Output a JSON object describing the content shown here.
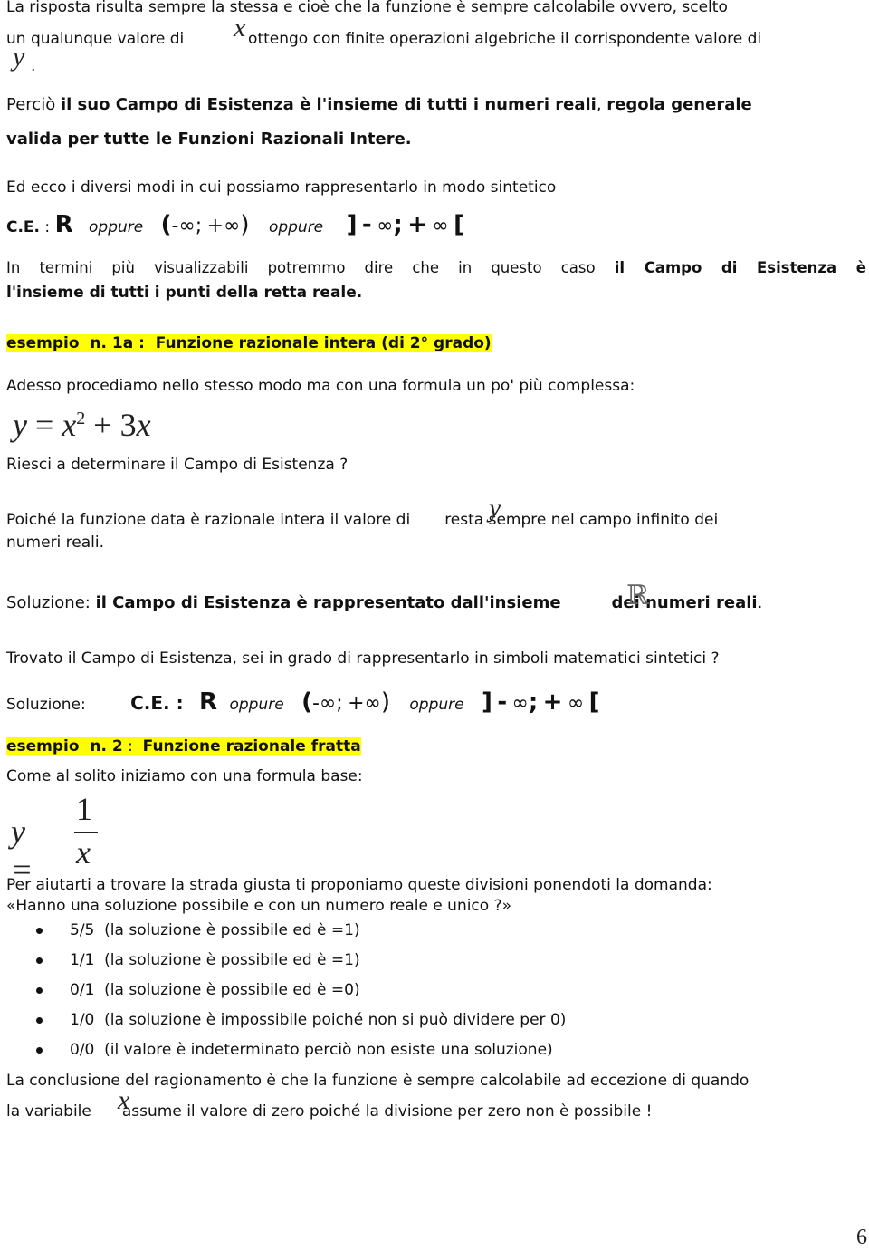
{
  "p1": {
    "line1": "La risposta risulta sempre la stessa e cioè che la funzione è sempre calcolabile ovvero, scelto",
    "line2_a": "un qualunque valore di",
    "var_x": "x",
    "line2_b": "ottengo con finite operazioni algebriche il corrispondente valore di",
    "var_y": "y",
    "period": "."
  },
  "p2": {
    "lead": "Perciò ",
    "bold1": "il suo Campo di Esistenza è l'insieme di tutti i numeri reali",
    "comma": ", ",
    "bold2": "regola generale",
    "line2": "valida per tutte le Funzioni Razionali Intere."
  },
  "p3": {
    "text": "Ed ecco i diversi modi in cui possiamo rappresentarlo in modo sintetico"
  },
  "ce1": {
    "label": "C.E.",
    "colon": " : ",
    "R": "R",
    "oppure": "oppure",
    "open_paren": "(",
    "neg_inf": "-∞",
    "semicolon": ";",
    "pos_inf": "+∞",
    "close_paren": ")",
    "open_bracket": "]",
    "minus": "-",
    "inf": "∞",
    "semi_b": ";",
    "plus": "+",
    "close_bracket": "["
  },
  "p4": {
    "text": "In termini più visualizzabili potremmo dire che in questo caso ",
    "bold": "il Campo di Esistenza è",
    "line2": "l'insieme di tutti i punti della retta reale."
  },
  "ex1": {
    "heading": "esempio  n. 1a :  Funzione razionale intera (di 2° grado)"
  },
  "p5": {
    "text": "Adesso procediamo nello stesso modo ma con una formula un po' più complessa:"
  },
  "formula1": "y = x² + 3x",
  "p6": {
    "text": "Riesci a determinare il Campo di Esistenza ?"
  },
  "p7": {
    "a": "Poiché la funzione data è razionale intera il valore di",
    "var_y": "y",
    "b": "resta sempre nel campo infinito dei",
    "line2": "numeri reali."
  },
  "sol1": {
    "label": "Soluzione: ",
    "bold": "il Campo di Esistenza è rappresentato dall'insieme",
    "R_symbol": "ℝ",
    "bold_end": "dei numeri reali",
    "period": "."
  },
  "p8": {
    "text": "Trovato il Campo di Esistenza, sei in grado di rappresentarlo in simboli matematici sintetici ?"
  },
  "sol2": {
    "label": "Soluzione:",
    "ce_label": "C.E. :"
  },
  "ex2": {
    "heading_bold1": "esempio  n. 2",
    "colon": " :  ",
    "heading_bold2": "Funzione razionale fratta"
  },
  "p9": {
    "text": "Come al solito iniziamo con una formula base:"
  },
  "formula2": {
    "lhs": "y =",
    "num": "1",
    "den": "x"
  },
  "p10": {
    "line1": "Per aiutarti a trovare la strada giusta ti proponiamo queste divisioni ponendoti la domanda:",
    "line2": "«Hanno una soluzione possibile e con un numero reale e unico ?»"
  },
  "bullets": [
    {
      "frac": "5/5",
      "text": "(la soluzione è possibile ed è =1)"
    },
    {
      "frac": "1/1",
      "text": "(la soluzione è possibile ed è =1)"
    },
    {
      "frac": "0/1",
      "text": "(la soluzione è possibile ed è =0)"
    },
    {
      "frac": "1/0",
      "text": "(la soluzione è impossibile poiché non si può dividere per 0)"
    },
    {
      "frac": "0/0",
      "text": "(il valore è indeterminato perciò non esiste una soluzione)"
    }
  ],
  "p11": {
    "line1": "La conclusione del ragionamento è che la funzione è sempre calcolabile ad eccezione di quando",
    "a": "la variabile",
    "var_x": "x",
    "b": "assume il valore di zero poiché la divisione per zero non è possibile !"
  },
  "page_number": "6"
}
